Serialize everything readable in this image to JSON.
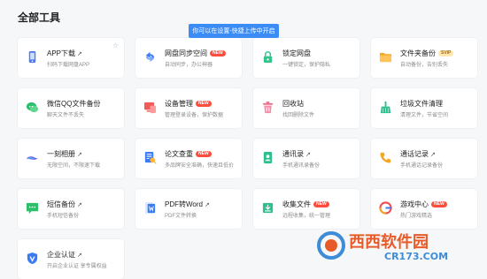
{
  "page": {
    "title": "全部工具"
  },
  "tooltip": "你可以在设置-快捷上传中开启",
  "tools": [
    {
      "name": "APP下载",
      "desc": "扫码下载网盘APP",
      "icon": "phone-icon",
      "color": "#4c7cf3",
      "star": "☆"
    },
    {
      "name": "网盘同步空间",
      "desc": "自动同步，办公神器",
      "icon": "sync-icon",
      "color": "#3b7cf4",
      "badge": "NEW",
      "badge_type": "new"
    },
    {
      "name": "锁定网盘",
      "desc": "一键锁定，保护隐私",
      "icon": "lock-icon",
      "color": "#35c48a"
    },
    {
      "name": "文件夹备份",
      "desc": "自动备份，告别丢失",
      "icon": "folder-icon",
      "color": "#f5a623",
      "badge": "SVIP",
      "badge_type": "vip"
    },
    {
      "name": "微信QQ文件备份",
      "desc": "聊天文件不丢失",
      "icon": "chat-icon",
      "color": "#2bbf6a"
    },
    {
      "name": "设备管理",
      "desc": "管理登录设备，保护数据",
      "icon": "device-icon",
      "color": "#f25a5a",
      "badge": "NEW",
      "badge_type": "new"
    },
    {
      "name": "回收站",
      "desc": "找回删除文件",
      "icon": "trash-icon",
      "color": "#f06b8a"
    },
    {
      "name": "垃圾文件清理",
      "desc": "清理文件，节省空间",
      "icon": "broom-icon",
      "color": "#2fbf8f"
    },
    {
      "name": "一刻相册",
      "desc": "无限空间，不限速下载",
      "icon": "album-icon",
      "color": "#6a5cf0"
    },
    {
      "name": "论文查重",
      "desc": "多品牌安全准确，快速且低价",
      "icon": "paper-icon",
      "color": "#3b7cf4",
      "badge": "NEW",
      "badge_type": "new"
    },
    {
      "name": "通讯录",
      "desc": "手机通讯录备份",
      "icon": "contacts-icon",
      "color": "#2fbf8f"
    },
    {
      "name": "通话记录",
      "desc": "手机通话记录备份",
      "icon": "call-icon",
      "color": "#f5a623"
    },
    {
      "name": "短信备份",
      "desc": "手机短信备份",
      "icon": "sms-icon",
      "color": "#2bbf6a"
    },
    {
      "name": "PDF转Word",
      "desc": "PDF文件转换",
      "icon": "pdf-icon",
      "color": "#3b7cf4"
    },
    {
      "name": "收集文件",
      "desc": "远程收集，统一管理",
      "icon": "collect-icon",
      "color": "#2fbf8f",
      "badge": "NEW",
      "badge_type": "new"
    },
    {
      "name": "游戏中心",
      "desc": "热门游戏精选",
      "icon": "game-icon",
      "color": "#ee4d4d",
      "badge": "NEW",
      "badge_type": "new"
    },
    {
      "name": "企业认证",
      "desc": "开启企业认证 享专属权益",
      "icon": "shield-icon",
      "color": "#3b7cf4"
    }
  ],
  "watermark": {
    "brand": "西西软件园",
    "domain": "CR173.COM"
  },
  "arrow_glyph": "↗"
}
